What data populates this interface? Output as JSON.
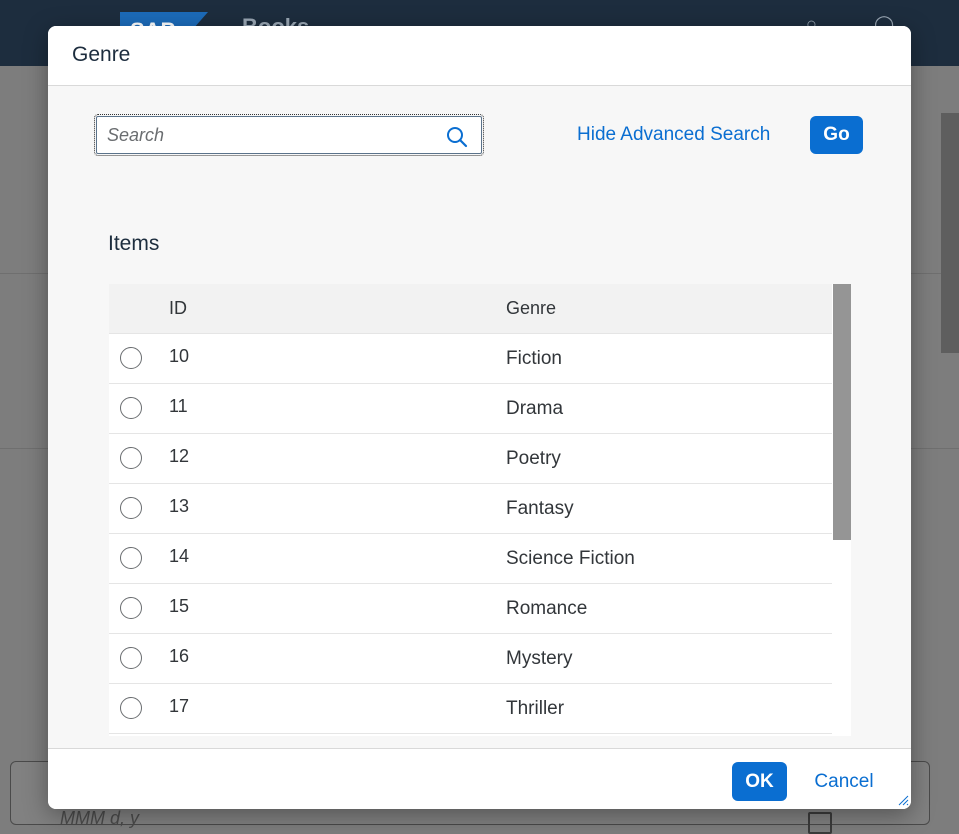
{
  "background": {
    "app_title": "Books",
    "logo_text": "SAP",
    "field_placeholder": "MMM d, y"
  },
  "dialog": {
    "title": "Genre",
    "search": {
      "placeholder": "Search",
      "value": ""
    },
    "advanced_search_label": "Hide Advanced Search",
    "go_label": "Go",
    "items_title": "Items",
    "columns": [
      "ID",
      "Genre"
    ],
    "rows": [
      {
        "id": "10",
        "genre": "Fiction"
      },
      {
        "id": "11",
        "genre": "Drama"
      },
      {
        "id": "12",
        "genre": "Poetry"
      },
      {
        "id": "13",
        "genre": "Fantasy"
      },
      {
        "id": "14",
        "genre": "Science Fiction"
      },
      {
        "id": "15",
        "genre": "Romance"
      },
      {
        "id": "16",
        "genre": "Mystery"
      },
      {
        "id": "17",
        "genre": "Thriller"
      }
    ],
    "ok_label": "OK",
    "cancel_label": "Cancel"
  },
  "colors": {
    "accent": "#0a6ed1",
    "shell": "#1d2d3e"
  }
}
